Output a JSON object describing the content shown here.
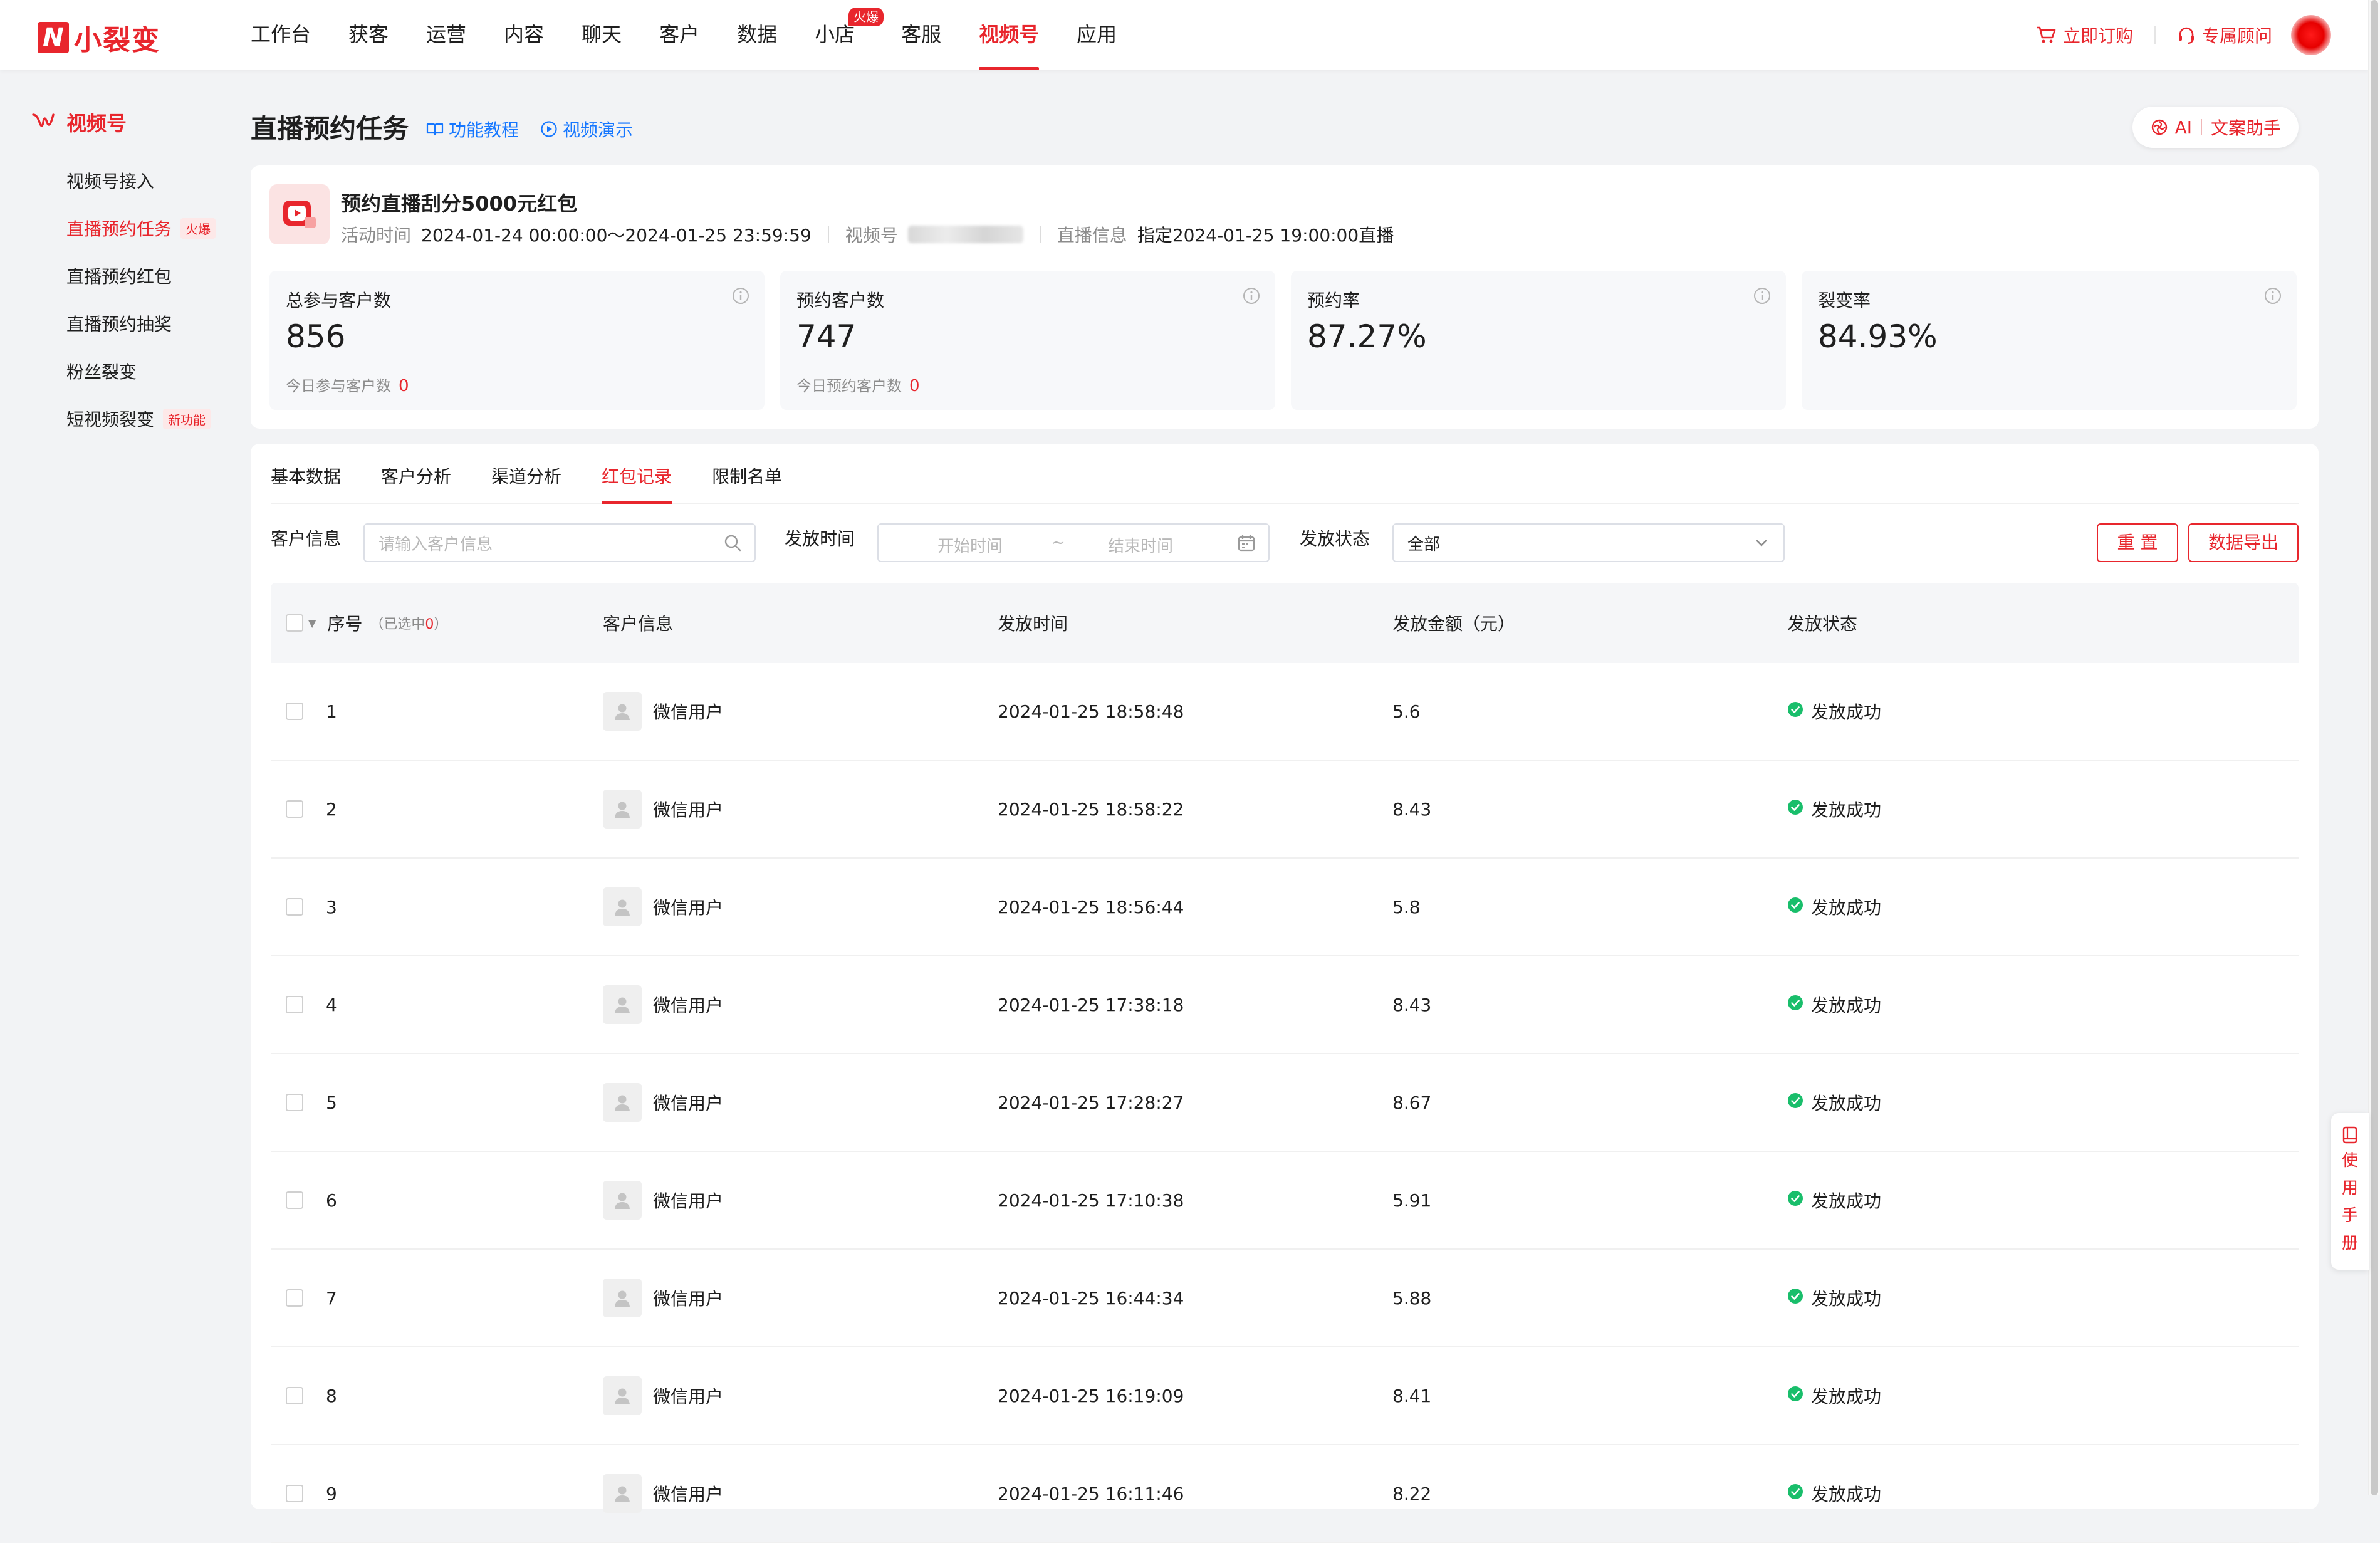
{
  "brand": {
    "name": "小裂变",
    "mark": "N"
  },
  "nav": {
    "items": [
      "工作台",
      "获客",
      "运营",
      "内容",
      "聊天",
      "客户",
      "数据",
      "小店",
      "客服",
      "视频号",
      "应用"
    ],
    "active": "视频号",
    "shop_badge": "火爆",
    "subscribe": "立即订购",
    "advisor": "专属顾问"
  },
  "sidebar": {
    "title": "视频号",
    "items": [
      {
        "label": "视频号接入",
        "tag": ""
      },
      {
        "label": "直播预约任务",
        "tag": "火爆"
      },
      {
        "label": "直播预约红包",
        "tag": ""
      },
      {
        "label": "直播预约抽奖",
        "tag": ""
      },
      {
        "label": "粉丝裂变",
        "tag": ""
      },
      {
        "label": "短视频裂变",
        "tag": "新功能"
      }
    ]
  },
  "page": {
    "title": "直播预约任务",
    "tutorial_link": "功能教程",
    "video_link": "视频演示",
    "ai_label": "AI",
    "ai_text": "文案助手"
  },
  "activity": {
    "name": "预约直播刮分5000元红包",
    "time_label": "活动时间",
    "time_value": "2024-01-24 00:00:00～2024-01-25 23:59:59",
    "channel_label": "视频号",
    "live_label": "直播信息",
    "live_value": "指定2024-01-25 19:00:00直播"
  },
  "stats": [
    {
      "label": "总参与客户数",
      "value": "856",
      "sub_label": "今日参与客户数",
      "sub_value": "0"
    },
    {
      "label": "预约客户数",
      "value": "747",
      "sub_label": "今日预约客户数",
      "sub_value": "0"
    },
    {
      "label": "预约率",
      "value": "87.27%",
      "sub_label": "",
      "sub_value": ""
    },
    {
      "label": "裂变率",
      "value": "84.93%",
      "sub_label": "",
      "sub_value": ""
    }
  ],
  "tabs": [
    "基本数据",
    "客户分析",
    "渠道分析",
    "红包记录",
    "限制名单"
  ],
  "active_tab": "红包记录",
  "filters": {
    "customer_label": "客户信息",
    "customer_placeholder": "请输入客户信息",
    "time_label": "发放时间",
    "start_placeholder": "开始时间",
    "range_sep": "~",
    "end_placeholder": "结束时间",
    "status_label": "发放状态",
    "status_value": "全部",
    "reset": "重 置",
    "export": "数据导出"
  },
  "table": {
    "columns": [
      "序号",
      "客户信息",
      "发放时间",
      "发放金额（元）",
      "发放状态"
    ],
    "selected_prefix": "（已选中",
    "selected_count": "0",
    "selected_suffix": "）",
    "rows": [
      {
        "no": "1",
        "user": "微信用户",
        "time": "2024-01-25 18:58:48",
        "amount": "5.6",
        "status": "发放成功"
      },
      {
        "no": "2",
        "user": "微信用户",
        "time": "2024-01-25 18:58:22",
        "amount": "8.43",
        "status": "发放成功"
      },
      {
        "no": "3",
        "user": "微信用户",
        "time": "2024-01-25 18:56:44",
        "amount": "5.8",
        "status": "发放成功"
      },
      {
        "no": "4",
        "user": "微信用户",
        "time": "2024-01-25 17:38:18",
        "amount": "8.43",
        "status": "发放成功"
      },
      {
        "no": "5",
        "user": "微信用户",
        "time": "2024-01-25 17:28:27",
        "amount": "8.67",
        "status": "发放成功"
      },
      {
        "no": "6",
        "user": "微信用户",
        "time": "2024-01-25 17:10:38",
        "amount": "5.91",
        "status": "发放成功"
      },
      {
        "no": "7",
        "user": "微信用户",
        "time": "2024-01-25 16:44:34",
        "amount": "5.88",
        "status": "发放成功"
      },
      {
        "no": "8",
        "user": "微信用户",
        "time": "2024-01-25 16:19:09",
        "amount": "8.41",
        "status": "发放成功"
      },
      {
        "no": "9",
        "user": "微信用户",
        "time": "2024-01-25 16:11:46",
        "amount": "8.22",
        "status": "发放成功"
      }
    ]
  },
  "manual": {
    "chars": [
      "使",
      "用",
      "手",
      "册"
    ]
  },
  "colors": {
    "accent": "#e8262d",
    "link": "#1677ff",
    "success": "#19be6b"
  }
}
